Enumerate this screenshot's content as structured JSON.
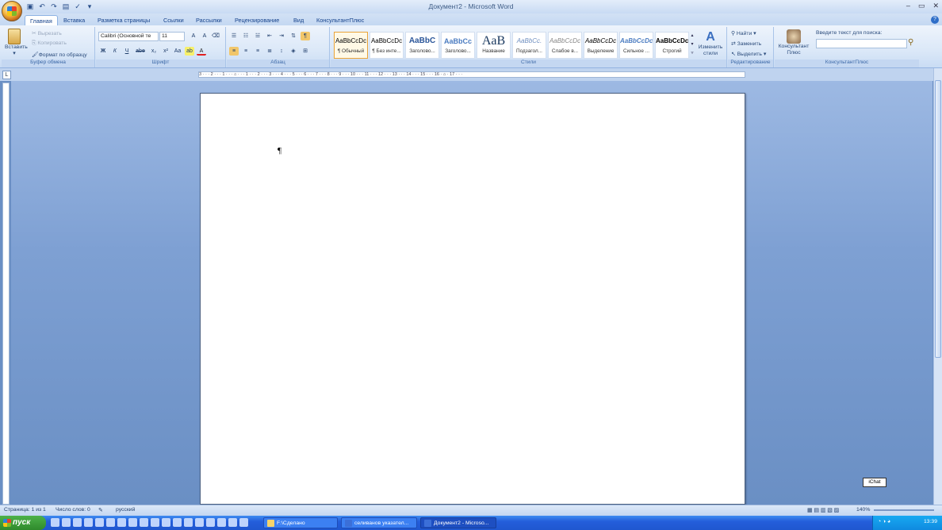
{
  "window": {
    "title": "Документ2 - Microsoft Word",
    "controls": [
      "–",
      "▭",
      "✕"
    ]
  },
  "tabs": [
    "Главная",
    "Вставка",
    "Разметка страницы",
    "Ссылки",
    "Рассылки",
    "Рецензирование",
    "Вид",
    "КонсультантПлюс"
  ],
  "clipboard": {
    "paste": "Вставить",
    "cut": "Вырезать",
    "copy": "Копировать",
    "format": "Формат по образцу",
    "label": "Буфер обмена"
  },
  "font": {
    "name": "Calibri (Основной те",
    "size": "11",
    "label": "Шрифт",
    "bold": "Ж",
    "italic": "К",
    "underline": "Ч",
    "strike": "abe",
    "sub": "x₂",
    "sup": "x²",
    "case": "Aa",
    "grow": "A",
    "shrink": "A"
  },
  "paragraph": {
    "label": "Абзац"
  },
  "styles": {
    "label": "Стили",
    "items": [
      {
        "preview": "AaBbCcDc",
        "name": "¶ Обычный"
      },
      {
        "preview": "AaBbCcDc",
        "name": "¶ Без инте..."
      },
      {
        "preview": "AaBbC",
        "name": "Заголово..."
      },
      {
        "preview": "AaBbCc",
        "name": "Заголово..."
      },
      {
        "preview": "AaB",
        "name": "Название"
      },
      {
        "preview": "AaBbCc.",
        "name": "Подзагол..."
      },
      {
        "preview": "AaBbCcDc",
        "name": "Слабое в..."
      },
      {
        "preview": "AaBbCcDc",
        "name": "Выделение"
      },
      {
        "preview": "AaBbCcDc",
        "name": "Сильное ..."
      },
      {
        "preview": "AaBbCcDc",
        "name": "Строгий"
      }
    ],
    "change": "Изменить стили"
  },
  "editing": {
    "label": "Редактирование",
    "find": "Найти",
    "replace": "Заменить",
    "select": "Выделить"
  },
  "consultant": {
    "btn": "Консультант Плюс",
    "search_label": "Введите текст для поиска:",
    "label": "КонсультантПлюс"
  },
  "ruler_text": "3 · · · 2 · · · 1 · · · ⌂ · · · 1 · · · 2 · · · 3 · · · 4 · · · 5 · · · 6 · · · 7 · · · 8 · · · 9 · · · 10 · · · 11 · · · 12 · · · 13 · · · 14 · · · 15 · · · 16 · ⌂ · 17 · · ·",
  "document": {
    "mark": "¶"
  },
  "ichat": "iChat",
  "status": {
    "page": "Страница: 1 из 1",
    "words": "Число слов: 0",
    "lang": "русский",
    "zoom": "140%"
  },
  "taskbar": {
    "start": "пуск",
    "tasks": [
      "F:\\Сделано",
      "селиванов указател...",
      "Документ2 - Microso..."
    ],
    "lang": "RU",
    "time": "13:39"
  }
}
